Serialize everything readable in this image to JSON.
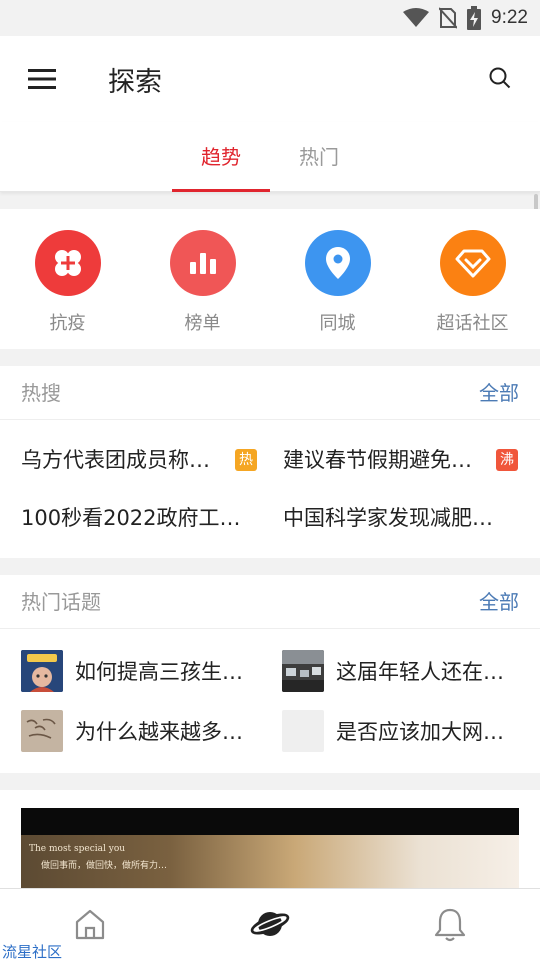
{
  "status_bar": {
    "time": "9:22",
    "icons": [
      "wifi-icon",
      "no-sim-icon",
      "battery-charging-icon"
    ]
  },
  "app_bar": {
    "title": "探索",
    "menu_icon": "hamburger-menu-icon",
    "search_icon": "search-icon"
  },
  "tabs": [
    {
      "label": "趋势",
      "active": true
    },
    {
      "label": "热门",
      "active": false
    }
  ],
  "shortcuts": [
    {
      "label": "抗疫",
      "icon": "clover-icon",
      "color": "#ee3b3b"
    },
    {
      "label": "榜单",
      "icon": "bar-chart-icon",
      "color": "#f05656"
    },
    {
      "label": "同城",
      "icon": "location-pin-icon",
      "color": "#3d95f0"
    },
    {
      "label": "超话社区",
      "icon": "diamond-icon",
      "color": "#fb8112"
    }
  ],
  "hot_search": {
    "title": "热搜",
    "more": "全部",
    "items": [
      {
        "text": "乌方代表团成员称…",
        "badge": "热",
        "badge_color": "#f5a623"
      },
      {
        "text": "建议春节假期避免…",
        "badge": "沸",
        "badge_color": "#f0563b"
      },
      {
        "text": "100秒看2022政府工…",
        "badge": ""
      },
      {
        "text": "中国科学家发现减肥…",
        "badge": ""
      }
    ]
  },
  "hot_topics": {
    "title": "热门话题",
    "more": "全部",
    "items": [
      {
        "text": "如何提高三孩生…",
        "thumb": "cartoon-thumbnail"
      },
      {
        "text": "这届年轻人还在…",
        "thumb": "office-photo-thumbnail"
      },
      {
        "text": "为什么越来越多…",
        "thumb": "calligraphy-thumbnail"
      },
      {
        "text": "是否应该加大网…",
        "thumb": "blank-thumbnail"
      }
    ]
  },
  "feed": {
    "caption": "The most special you",
    "subcaption": "做回事而，做回快，做所有力…"
  },
  "bottom_nav": [
    {
      "name": "home",
      "icon": "home-icon",
      "active": false
    },
    {
      "name": "discover",
      "icon": "planet-icon",
      "active": true
    },
    {
      "name": "notifications",
      "icon": "bell-icon",
      "active": false
    }
  ],
  "watermark": "流星社区"
}
